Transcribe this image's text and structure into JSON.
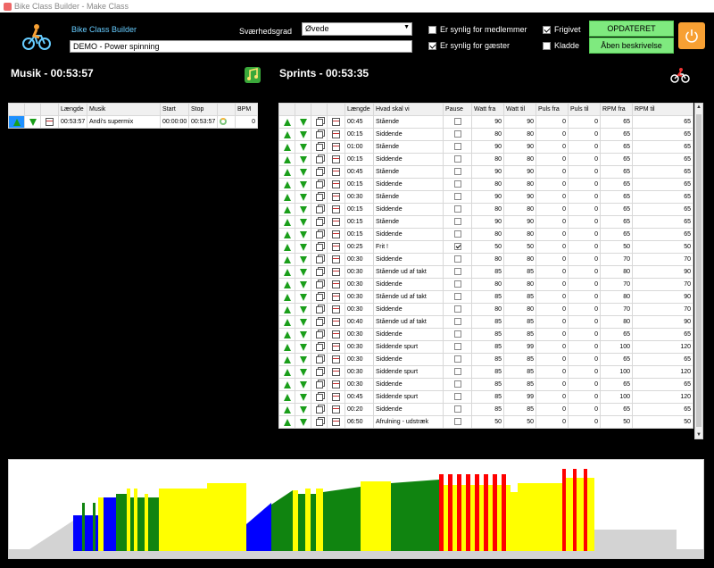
{
  "window": {
    "title": "Bike Class Builder - Make Class"
  },
  "header": {
    "app_name": "Bike Class Builder",
    "class_name": "DEMO - Power spinning",
    "difficulty_label": "Sværhedsgrad",
    "difficulty_value": "Øvede",
    "visible_members_label": "Er synlig for medlemmer",
    "visible_members_checked": false,
    "visible_guests_label": "Er synlig for gæster",
    "visible_guests_checked": true,
    "released_label": "Frigivet",
    "released_checked": true,
    "draft_label": "Kladde",
    "draft_checked": false,
    "update_button": "OPDATERET",
    "open_description_button": "Åben beskrivelse"
  },
  "music": {
    "title": "Musik - 00:53:57",
    "columns": [
      "",
      "",
      "",
      "Længde",
      "Musik",
      "Start",
      "Stop",
      "",
      "BPM"
    ],
    "rows": [
      {
        "length": "00:53:57",
        "music": "Andi's supermix",
        "start": "00:00:00",
        "stop": "00:53:57",
        "bpm": "0"
      }
    ]
  },
  "sprints": {
    "title": "Sprints - 00:53:35",
    "columns": [
      "",
      "",
      "",
      "",
      "Længde",
      "Hvad skal vi",
      "Pause",
      "Watt fra",
      "Watt til",
      "Puls fra",
      "Puls til",
      "RPM fra",
      "RPM til"
    ],
    "rows": [
      {
        "length": "00:45",
        "what": "Stående",
        "pause": false,
        "watt_from": "90",
        "watt_to": "90",
        "pulse_from": "0",
        "pulse_to": "0",
        "rpm_from": "65",
        "rpm_to": "65"
      },
      {
        "length": "00:15",
        "what": "Siddende",
        "pause": false,
        "watt_from": "80",
        "watt_to": "80",
        "pulse_from": "0",
        "pulse_to": "0",
        "rpm_from": "65",
        "rpm_to": "65"
      },
      {
        "length": "01:00",
        "what": "Stående",
        "pause": false,
        "watt_from": "90",
        "watt_to": "90",
        "pulse_from": "0",
        "pulse_to": "0",
        "rpm_from": "65",
        "rpm_to": "65"
      },
      {
        "length": "00:15",
        "what": "Siddende",
        "pause": false,
        "watt_from": "80",
        "watt_to": "80",
        "pulse_from": "0",
        "pulse_to": "0",
        "rpm_from": "65",
        "rpm_to": "65"
      },
      {
        "length": "00:45",
        "what": "Stående",
        "pause": false,
        "watt_from": "90",
        "watt_to": "90",
        "pulse_from": "0",
        "pulse_to": "0",
        "rpm_from": "65",
        "rpm_to": "65"
      },
      {
        "length": "00:15",
        "what": "Siddende",
        "pause": false,
        "watt_from": "80",
        "watt_to": "80",
        "pulse_from": "0",
        "pulse_to": "0",
        "rpm_from": "65",
        "rpm_to": "65"
      },
      {
        "length": "00:30",
        "what": "Stående",
        "pause": false,
        "watt_from": "90",
        "watt_to": "90",
        "pulse_from": "0",
        "pulse_to": "0",
        "rpm_from": "65",
        "rpm_to": "65"
      },
      {
        "length": "00:15",
        "what": "Siddende",
        "pause": false,
        "watt_from": "80",
        "watt_to": "80",
        "pulse_from": "0",
        "pulse_to": "0",
        "rpm_from": "65",
        "rpm_to": "65"
      },
      {
        "length": "00:15",
        "what": "Stående",
        "pause": false,
        "watt_from": "90",
        "watt_to": "90",
        "pulse_from": "0",
        "pulse_to": "0",
        "rpm_from": "65",
        "rpm_to": "65"
      },
      {
        "length": "00:15",
        "what": "Siddende",
        "pause": false,
        "watt_from": "80",
        "watt_to": "80",
        "pulse_from": "0",
        "pulse_to": "0",
        "rpm_from": "65",
        "rpm_to": "65"
      },
      {
        "length": "00:25",
        "what": "Frit !",
        "pause": true,
        "watt_from": "50",
        "watt_to": "50",
        "pulse_from": "0",
        "pulse_to": "0",
        "rpm_from": "50",
        "rpm_to": "50"
      },
      {
        "length": "00:30",
        "what": "Siddende",
        "pause": false,
        "watt_from": "80",
        "watt_to": "80",
        "pulse_from": "0",
        "pulse_to": "0",
        "rpm_from": "70",
        "rpm_to": "70"
      },
      {
        "length": "00:30",
        "what": "Stående ud af takt",
        "pause": false,
        "watt_from": "85",
        "watt_to": "85",
        "pulse_from": "0",
        "pulse_to": "0",
        "rpm_from": "80",
        "rpm_to": "90"
      },
      {
        "length": "00:30",
        "what": "Siddende",
        "pause": false,
        "watt_from": "80",
        "watt_to": "80",
        "pulse_from": "0",
        "pulse_to": "0",
        "rpm_from": "70",
        "rpm_to": "70"
      },
      {
        "length": "00:30",
        "what": "Stående ud af takt",
        "pause": false,
        "watt_from": "85",
        "watt_to": "85",
        "pulse_from": "0",
        "pulse_to": "0",
        "rpm_from": "80",
        "rpm_to": "90"
      },
      {
        "length": "00:30",
        "what": "Siddende",
        "pause": false,
        "watt_from": "80",
        "watt_to": "80",
        "pulse_from": "0",
        "pulse_to": "0",
        "rpm_from": "70",
        "rpm_to": "70"
      },
      {
        "length": "00:40",
        "what": "Stående ud af takt",
        "pause": false,
        "watt_from": "85",
        "watt_to": "85",
        "pulse_from": "0",
        "pulse_to": "0",
        "rpm_from": "80",
        "rpm_to": "90"
      },
      {
        "length": "00:30",
        "what": "Siddende",
        "pause": false,
        "watt_from": "85",
        "watt_to": "85",
        "pulse_from": "0",
        "pulse_to": "0",
        "rpm_from": "65",
        "rpm_to": "65"
      },
      {
        "length": "00:30",
        "what": "Siddende spurt",
        "pause": false,
        "watt_from": "85",
        "watt_to": "99",
        "pulse_from": "0",
        "pulse_to": "0",
        "rpm_from": "100",
        "rpm_to": "120"
      },
      {
        "length": "00:30",
        "what": "Siddende",
        "pause": false,
        "watt_from": "85",
        "watt_to": "85",
        "pulse_from": "0",
        "pulse_to": "0",
        "rpm_from": "65",
        "rpm_to": "65"
      },
      {
        "length": "00:30",
        "what": "Siddende spurt",
        "pause": false,
        "watt_from": "85",
        "watt_to": "85",
        "pulse_from": "0",
        "pulse_to": "0",
        "rpm_from": "100",
        "rpm_to": "120"
      },
      {
        "length": "00:30",
        "what": "Siddende",
        "pause": false,
        "watt_from": "85",
        "watt_to": "85",
        "pulse_from": "0",
        "pulse_to": "0",
        "rpm_from": "65",
        "rpm_to": "65"
      },
      {
        "length": "00:45",
        "what": "Siddende spurt",
        "pause": false,
        "watt_from": "85",
        "watt_to": "99",
        "pulse_from": "0",
        "pulse_to": "0",
        "rpm_from": "100",
        "rpm_to": "120"
      },
      {
        "length": "00:20",
        "what": "Siddende",
        "pause": false,
        "watt_from": "85",
        "watt_to": "85",
        "pulse_from": "0",
        "pulse_to": "0",
        "rpm_from": "65",
        "rpm_to": "65"
      },
      {
        "length": "06:50",
        "what": "Afrulning - udstræk",
        "pause": false,
        "watt_from": "50",
        "watt_to": "50",
        "pulse_from": "0",
        "pulse_to": "0",
        "rpm_from": "50",
        "rpm_to": "50"
      }
    ]
  },
  "profile_colors": {
    "warmup": "#d3d3d3",
    "blue": "#0000ff",
    "green": "#108410",
    "yellow": "#ffff00",
    "red": "#ff0000",
    "gray": "#d3d3d3"
  }
}
